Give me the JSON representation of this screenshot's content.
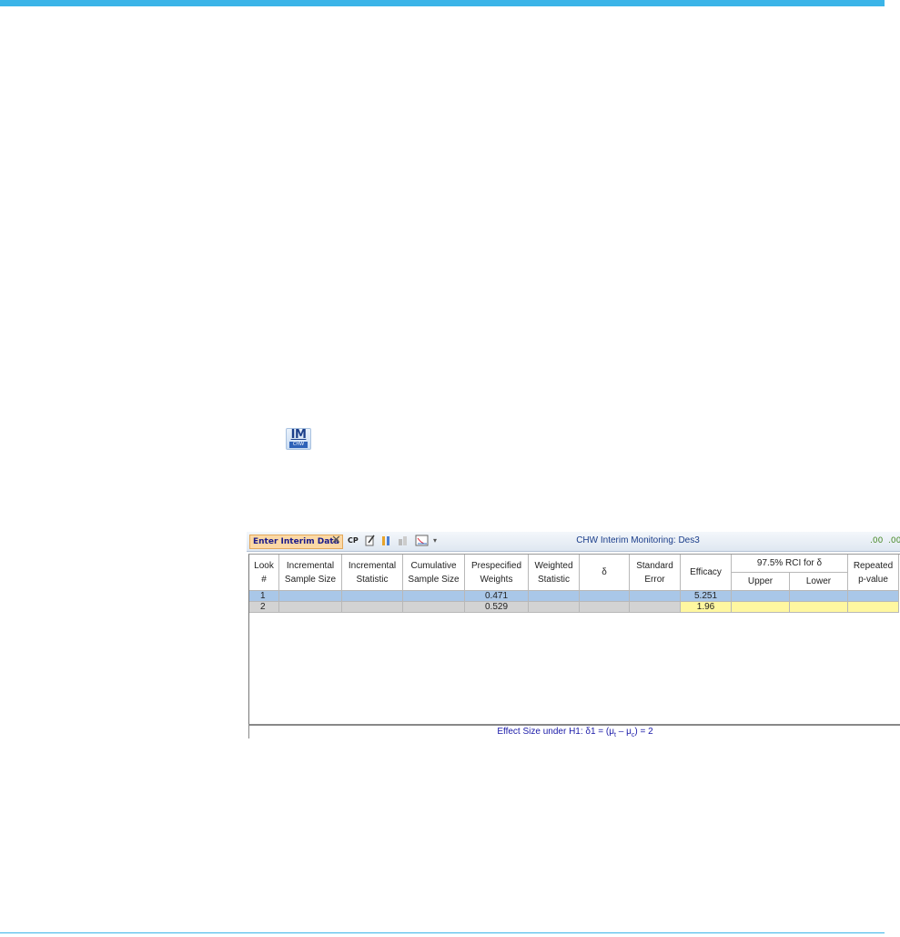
{
  "icon": {
    "main": "IM",
    "sub": "CHW"
  },
  "toolbar": {
    "enter_label": "Enter Interim Data",
    "cp_label": "CP",
    "title": "CHW Interim Monitoring: Des3"
  },
  "table": {
    "headers": {
      "look": [
        "Look",
        "#"
      ],
      "inc_ss": [
        "Incremental",
        "Sample Size"
      ],
      "inc_stat": [
        "Incremental",
        "Statistic"
      ],
      "cum_ss": [
        "Cumulative",
        "Sample Size"
      ],
      "weights": [
        "Prespecified",
        "Weights"
      ],
      "wstat": [
        "Weighted",
        "Statistic"
      ],
      "delta": "δ",
      "se": [
        "Standard",
        "Error"
      ],
      "efficacy": "Efficacy",
      "rci": "97.5% RCI for δ",
      "upper": "Upper",
      "lower": "Lower",
      "pval": [
        "Repeated",
        "p-value"
      ]
    },
    "rows": [
      {
        "look": "1",
        "weights": "0.471",
        "efficacy": "5.251"
      },
      {
        "look": "2",
        "weights": "0.529",
        "efficacy": "1.96"
      }
    ]
  },
  "footer": {
    "prefix": "Effect Size under H1: δ1 = (μ",
    "sub_t": "t",
    "mid": " – μ",
    "sub_c": "c",
    "suffix": ") = 2"
  }
}
